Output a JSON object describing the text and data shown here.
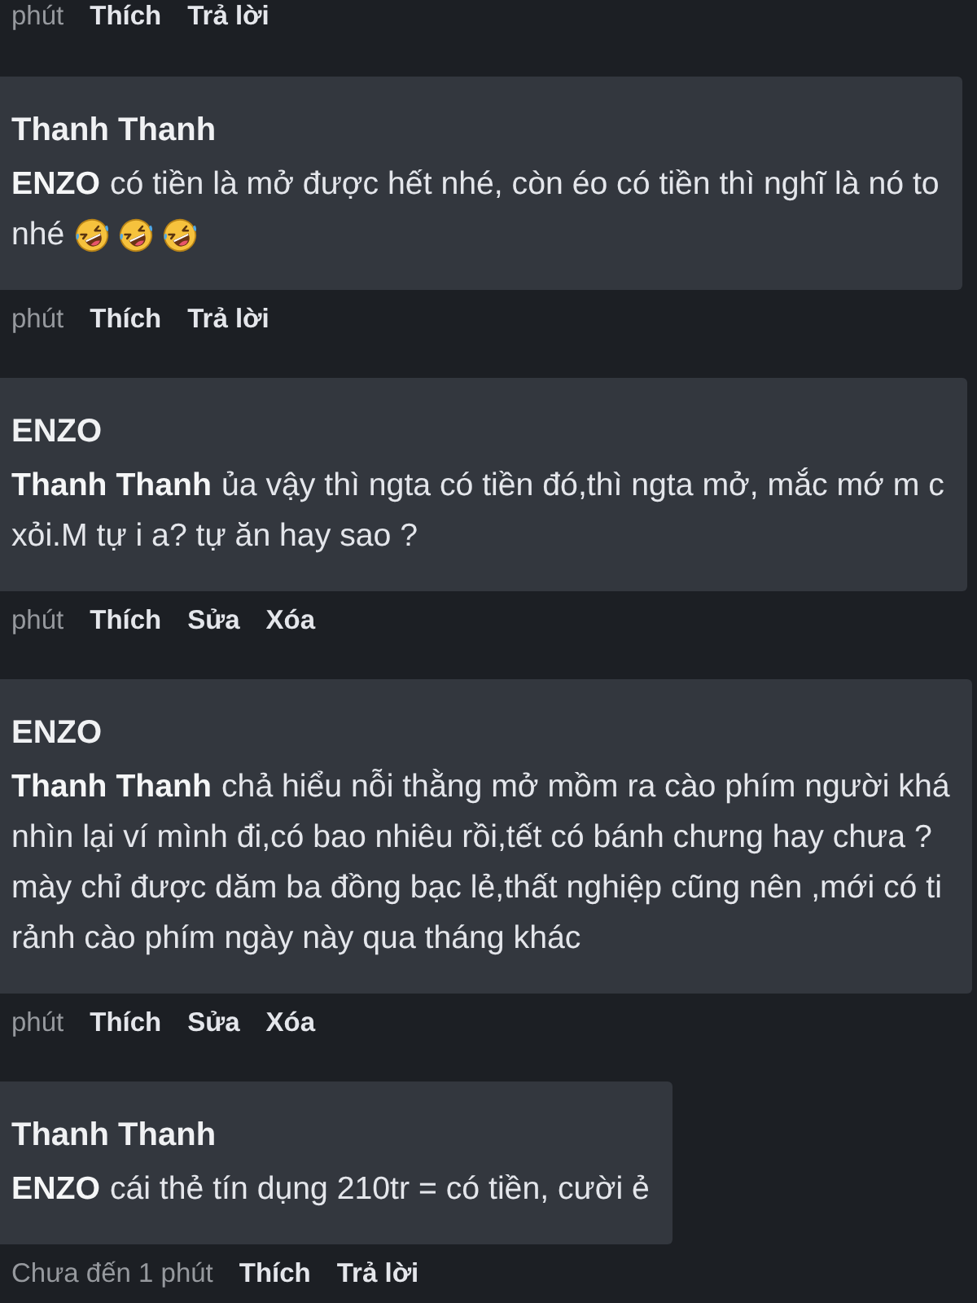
{
  "feed": [
    {
      "kind": "actions",
      "time": "phút",
      "actions": [
        "Thích",
        "Trả lời"
      ]
    },
    {
      "kind": "comment",
      "author": "Thanh Thanh",
      "lines": [
        {
          "text": "**ENZO** có tiền là mở được hết nhé, còn éo có tiền thì nghĩ là nó to"
        },
        {
          "text": "nhé",
          "emojis": [
            {
              "kind": "rofl"
            },
            {
              "kind": "rofl"
            },
            {
              "kind": "rofl"
            }
          ]
        }
      ]
    },
    {
      "kind": "actions",
      "time": "phút",
      "actions": [
        "Thích",
        "Trả lời"
      ]
    },
    {
      "kind": "comment",
      "author": "ENZO",
      "lines": [
        {
          "text": "**Thanh Thanh** ủa vậy thì ngta có tiền đó,thì ngta mở, mắc mớ m c"
        },
        {
          "text": "xỏi.M tự i a? tự ăn hay sao ?"
        }
      ]
    },
    {
      "kind": "actions",
      "time": "phút",
      "actions": [
        "Thích",
        "Sửa",
        "Xóa"
      ]
    },
    {
      "kind": "comment",
      "author": "ENZO",
      "lines": [
        {
          "text": "**Thanh Thanh** chả hiểu nỗi thằng mở mồm ra cào phím người khá"
        },
        {
          "text": "nhìn lại ví mình đi,có bao nhiêu rồi,tết có bánh chưng hay chưa ?"
        },
        {
          "text": "mày chỉ được dăm ba đồng bạc lẻ,thất nghiệp cũng nên ,mới có ti"
        },
        {
          "text": "rảnh cào phím ngày này qua tháng khác"
        }
      ]
    },
    {
      "kind": "actions",
      "time": "phút",
      "actions": [
        "Thích",
        "Sửa",
        "Xóa"
      ]
    },
    {
      "kind": "comment",
      "author": "Thanh Thanh",
      "lines": [
        {
          "text": "**ENZO** cái thẻ tín dụng 210tr = có tiền, cười ẻ"
        }
      ]
    },
    {
      "kind": "actions",
      "time": "Chưa đến 1 phút",
      "actions": [
        "Thích",
        "Trả lời"
      ]
    }
  ]
}
